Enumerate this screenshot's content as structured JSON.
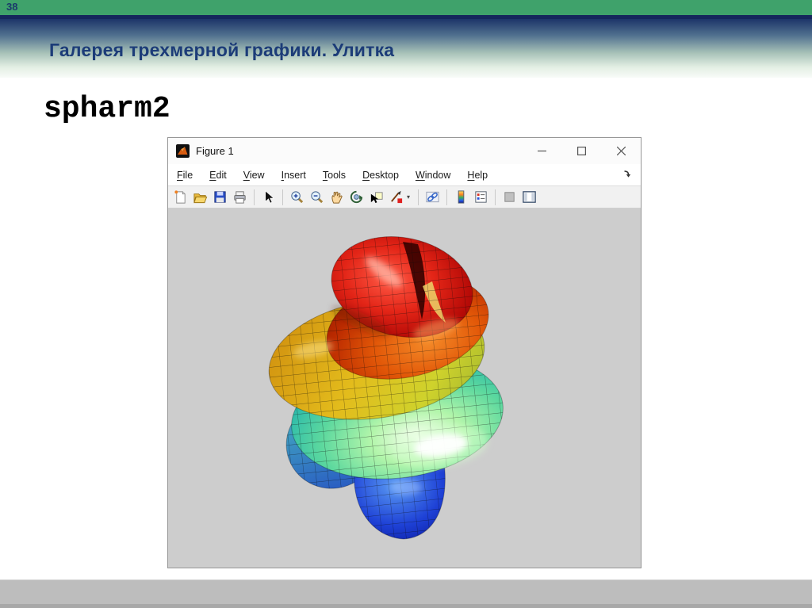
{
  "slide": {
    "number": "38",
    "title": "Галерея трехмерной графики. Улитка",
    "code_label": "spharm2",
    "colors": {
      "top_bar_green": "#3fa26b",
      "divider_navy": "#15265c",
      "title_text": "#1c3c78",
      "bottom_bar_gray": "#bdbdbd",
      "body_background": "#ffffff"
    }
  },
  "figure_window": {
    "title": "Figure 1",
    "app_icon": "matlab-logo-icon",
    "window_controls": [
      "minimize",
      "maximize",
      "close"
    ],
    "menu": [
      "File",
      "Edit",
      "View",
      "Insert",
      "Tools",
      "Desktop",
      "Window",
      "Help"
    ],
    "menu_overflow_icon": "dock-figure-arrow-icon",
    "toolbar_icons": [
      "new-figure",
      "open-file",
      "save-figure",
      "print-figure",
      "edit-plot-pointer",
      "zoom-in",
      "zoom-out",
      "pan-hand",
      "rotate-3d",
      "data-cursor",
      "brush-data",
      "link-plot",
      "insert-colorbar",
      "insert-legend",
      "hide-plot-tools",
      "show-plot-tools"
    ],
    "plot": {
      "type": "3d-surface",
      "description": "Shaded 3D spherical-harmonic snail-shaped surface with black mesh lines",
      "colormap": "jet",
      "colormap_colors_top_to_bottom": [
        "#b00808",
        "#e25808",
        "#e0c01e",
        "#8ce08c",
        "#2fbcaa",
        "#1633cc"
      ],
      "canvas_background": "#cdcdcd",
      "mesh_visible": true
    }
  }
}
